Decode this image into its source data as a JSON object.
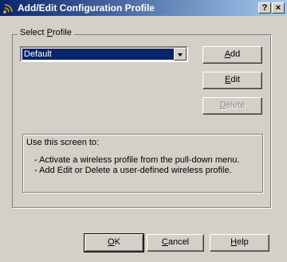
{
  "window": {
    "title": "Add/Edit Configuration Profile",
    "help_label": "?",
    "close_label": "×"
  },
  "profile_group": {
    "label_prefix": "Select ",
    "label_accel": "P",
    "label_rest": "rofile",
    "selected": "Default"
  },
  "buttons": {
    "add": {
      "accel": "A",
      "rest": "dd",
      "enabled": true
    },
    "edit": {
      "accel": "E",
      "rest": "dit",
      "enabled": true
    },
    "delete": {
      "accel": "D",
      "rest": "elete",
      "enabled": false
    },
    "ok": {
      "accel": "O",
      "rest": "K"
    },
    "cancel": {
      "accel": "C",
      "rest": "ancel"
    },
    "help": {
      "accel": "H",
      "rest": "elp"
    }
  },
  "info": {
    "heading": "Use this screen to:",
    "items": [
      "-  Activate a wireless profile from the pull-down menu.",
      "-  Add Edit or Delete a user-defined wireless profile."
    ]
  },
  "colors": {
    "title_bar": "#0a246a",
    "face": "#d4d0c8"
  }
}
